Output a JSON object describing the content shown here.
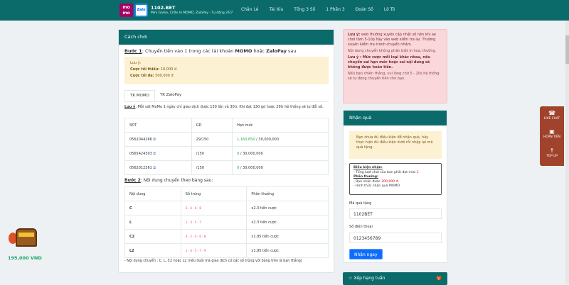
{
  "header": {
    "logo_momo": "momo",
    "logo_zalo": "Zalo Pay",
    "brand": "1102.BET",
    "tagline": "Mini Game, Chẵn lẻ MOMO, ZaloPay - Tự động 24/7",
    "nav": [
      "Chẵn Lẻ",
      "Tài Xỉu",
      "Tổng 3 Số",
      "1 Phần 3",
      "Đoán Số",
      "Lô Tô"
    ]
  },
  "howto": {
    "title": "Cách chơi",
    "step1_label": "Bước 1",
    "step1_text": ": Chuyển tiền vào 1 trong các tài khoản ",
    "step1_momo": "MOMO",
    "step1_or": " hoặc ",
    "step1_zalo": "ZaloPay",
    "step1_end": " sau",
    "note_title": "Lưu ý:",
    "min_label": "Cược tối thiểu:",
    "min_value": " 10,000 đ",
    "max_label": "Cược tối đa:",
    "max_value": " 500,000 đ",
    "tabs": [
      "TK MOMO",
      "TK ZaloPay"
    ],
    "limit_label": "Lưu ý",
    "limit_text": ": Mỗi sdt MoMo 1 ngày chỉ giao dịch được 150 lần và 30tr. Khi đạt 130 gd hoặc 29tr hệ thống sẽ tự đổi số.",
    "accounts_headers": [
      "SĐT",
      "GD",
      "Hạn mức"
    ],
    "accounts": [
      {
        "phone": "0562044266",
        "gd": "29/150",
        "used": "1,160,650",
        "limit": " / 30,000,000"
      },
      {
        "phone": "0565424303",
        "gd": "/150",
        "used": "0",
        "limit": " / 30,000,000"
      },
      {
        "phone": "0562012361",
        "gd": "/150",
        "used": "0",
        "limit": " / 30,000,000"
      }
    ],
    "step2_label": "Bước 2",
    "step2_text": ": Nội dung chuyển theo bảng sau:",
    "rules_headers": [
      "Nội dung",
      "Số trúng",
      "Phần thưởng"
    ],
    "rules": [
      {
        "c": "C",
        "n": "2 - 4 - 6 - 8",
        "r": "x2.3 tiền cược"
      },
      {
        "c": "L",
        "n": "1 - 3 - 5 - 7",
        "r": "x2.3 tiền cược"
      },
      {
        "c": "C2",
        "n": "0 - 2 - 4 - 6 - 8",
        "r": "x1.95 tiền cược"
      },
      {
        "c": "L2",
        "n": "1 - 3 - 5 - 7 - 9",
        "r": "x1.95 tiền cược"
      }
    ],
    "footer": "- Nội dung chuyển : C, L, C2 hoặc L2 (nếu đuôi mã giao dịch có các số trùng với bảng trên là bạn thắng)"
  },
  "alert": {
    "p1_label": "Lưu ý:",
    "p1": " web thường xuyên cập nhật số nên khi ae chơi tầm 5-10p hãy vào web kiểm tra lại. Thường xuyên kiểm tra tránh chuyển nhầm.",
    "p2": "Nội dung chuyển không phân biệt in hoa, thường.",
    "p3": "Lưu ý : Mức cược mỗi loại khác nhau, nếu chuyển sai hạn mức hoặc sai nội dung sẽ không được hoàn tiền.",
    "p4": "Nếu bạn chiến thắng, vui lòng chờ 5 - 20s hệ thống sẽ tự động chuyển tiền cho bạn."
  },
  "gift": {
    "title": "Nhận quà",
    "warn": "Bạn chưa đủ điều kiện để nhận quà, hãy thực hiện đủ điều kiện dưới rồi nhập lại mã quà tặng.",
    "cond_title": "Điều kiện nhận:",
    "cond": "- Tổng lượt chơi của bạn phải đạt mức ",
    "cond_value": "1",
    "reward_title": "Phần thưởng:",
    "reward": "- Bạn nhận được ",
    "reward_value": "200,000 đ",
    "method": "- Hình thức nhận quà MOMO",
    "code_label": "Mã quà tặng",
    "code_value": "1102BET",
    "phone_label": "Số điện thoại",
    "phone_value": "0123456789",
    "submit": "Nhận ngay"
  },
  "ranking": {
    "title": "Xếp hạng tuần"
  },
  "float": {
    "items": [
      "LIVE CHAT",
      "HOÀN TIỀN",
      "TOP UP"
    ]
  },
  "jackpot": {
    "amount": "195,000 VND"
  },
  "colors": {
    "header": "#0b6b6b",
    "float": "#a0432c",
    "button": "#0d6efd",
    "green": "#28a745",
    "pink": "#e83e8c"
  }
}
